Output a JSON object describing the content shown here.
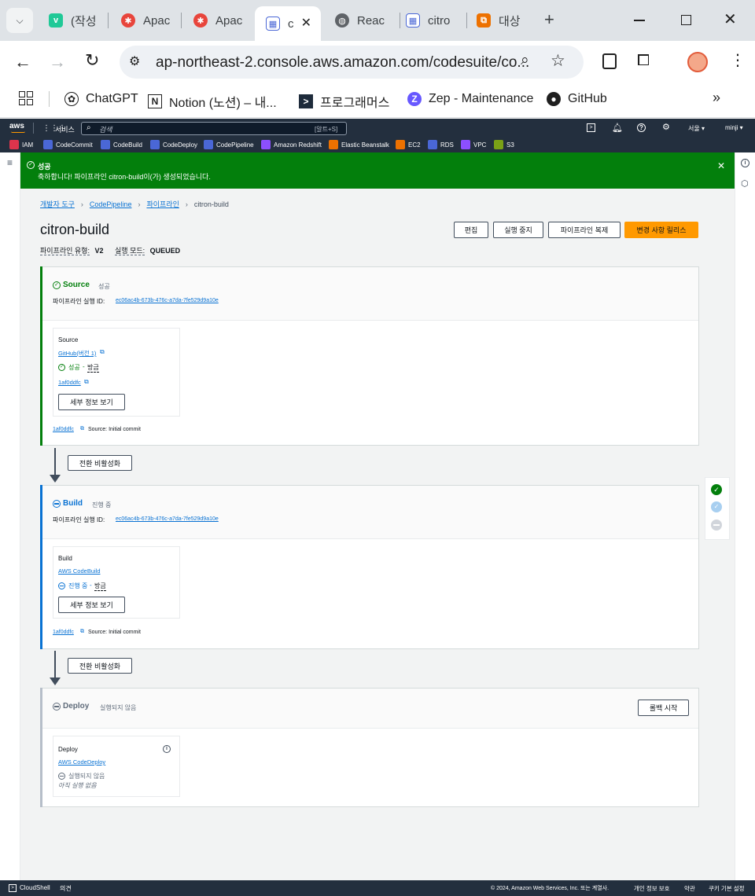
{
  "browser": {
    "tabs": [
      {
        "title": "(작성",
        "icon": "v-icon",
        "color": "#20c997"
      },
      {
        "title": "Apac",
        "icon": "apache-icon",
        "color": "#e8453c"
      },
      {
        "title": "Apac",
        "icon": "apache-icon",
        "color": "#e8453c"
      },
      {
        "title": "c",
        "icon": "codepipeline-icon",
        "color": "#4a67d6"
      },
      {
        "title": "Reac",
        "icon": "globe-icon",
        "color": "#5f6368"
      },
      {
        "title": "citro",
        "icon": "codepipeline-icon",
        "color": "#4a67d6"
      },
      {
        "title": "대상",
        "icon": "target-group-icon",
        "color": "#ed7100"
      }
    ],
    "url": "ap-northeast-2.console.aws.amazon.com/codesuite/co...",
    "bookmarks": [
      "ChatGPT",
      "Notion (노션) – 내...",
      "프로그래머스",
      "Zep - Maintenance",
      "GitHub"
    ]
  },
  "aws_nav": {
    "logo": "aws",
    "services": "서비스",
    "search_placeholder": "검색",
    "search_shortcut": "[알트+S]",
    "region": "서울 ▾",
    "user": "minji ▾",
    "favorites": [
      "IAM",
      "CodeCommit",
      "CodeBuild",
      "CodeDeploy",
      "CodePipeline",
      "Amazon Redshift",
      "Elastic Beanstalk",
      "EC2",
      "RDS",
      "VPC",
      "S3"
    ]
  },
  "flash": {
    "title": "성공",
    "message": "축하합니다! 파이프라인 citron-build이(가) 생성되었습니다."
  },
  "breadcrumb": [
    "개발자 도구",
    "CodePipeline",
    "파이프라인",
    "citron-build"
  ],
  "page": {
    "title": "citron-build",
    "pipeline_type_label": "파이프라인 유형:",
    "pipeline_type": "V2",
    "exec_mode_label": "실행 모드:",
    "exec_mode": "QUEUED"
  },
  "header_buttons": {
    "edit": "편집",
    "stop": "실행 중지",
    "clone": "파이프라인 복제",
    "release": "변경 사항 릴리스"
  },
  "colors": {
    "success": "#037f0c",
    "in_progress": "#0972d3",
    "not_started": "#5f6b7a",
    "primary_button": "#ff9900",
    "nav": "#232f3e"
  },
  "stages": [
    {
      "name": "Source",
      "status": "성공",
      "exec_id_label": "파이프라인 실행 ID:",
      "exec_id": "ec06ac4b-673b-476c-a7da-7fe529d9a10e",
      "action": {
        "name": "Source",
        "provider": "GitHub(버전 1)",
        "status": "성공",
        "time": "방금",
        "commit": "1af0ddfc",
        "details": "세부 정보 보기"
      },
      "commit": "1af0ddfc",
      "commit_msg": "Source: Initial commit",
      "transition": "전환 비활성화"
    },
    {
      "name": "Build",
      "status": "진행 중",
      "exec_id_label": "파이프라인 실행 ID:",
      "exec_id": "ec06ac4b-673b-476c-a7da-7fe529d9a10e",
      "action": {
        "name": "Build",
        "provider": "AWS CodeBuild",
        "status": "진행 중",
        "time": "방금",
        "details": "세부 정보 보기"
      },
      "commit": "1af0ddfc",
      "commit_msg": "Source: Initial commit",
      "transition": "전환 비활성화"
    },
    {
      "name": "Deploy",
      "status": "실행되지 않음",
      "retry": "롤백 시작",
      "action": {
        "name": "Deploy",
        "provider": "AWS CodeDeploy",
        "status": "실행되지 않음",
        "note": "아직 실행 없음"
      }
    }
  ],
  "footer": {
    "cloudshell": "CloudShell",
    "feedback": "의견",
    "copyright": "© 2024, Amazon Web Services, Inc. 또는 계열사.",
    "privacy": "개인 정보 보호",
    "terms": "약관",
    "cookies": "쿠키 기본 설정"
  }
}
